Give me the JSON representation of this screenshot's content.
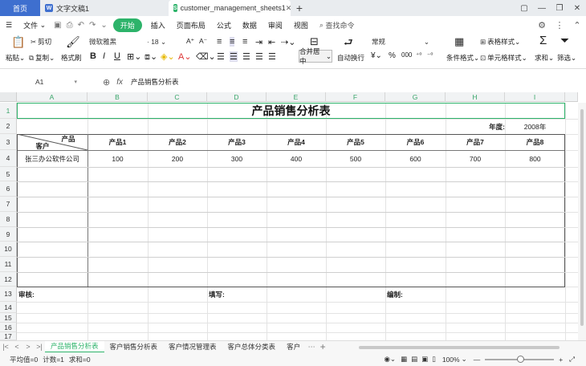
{
  "tabs": [
    {
      "label": "首页"
    },
    {
      "label": "文字文稿1"
    },
    {
      "label": "customer_management_sheets1"
    }
  ],
  "menu": {
    "file": "文件",
    "start": "开始",
    "items": [
      "插入",
      "页面布局",
      "公式",
      "数据",
      "审阅",
      "视图"
    ],
    "search": "查找命令"
  },
  "ribbon": {
    "cut": "剪切",
    "paste": "粘贴",
    "copy": "复制",
    "format_painter": "格式刷",
    "font_name": "微软雅黑",
    "font_size": "18",
    "merge_center": "合并居中",
    "wrap": "自动换行",
    "number_format": "常规",
    "conditional": "条件格式",
    "table_style": "表格样式",
    "cell_style": "单元格样式",
    "sum": "求和",
    "filter": "筛选"
  },
  "formula_bar": {
    "cell_ref": "A1",
    "fx": "fx",
    "content": "产品销售分析表"
  },
  "columns": [
    "A",
    "B",
    "C",
    "D",
    "E",
    "F",
    "G",
    "H",
    "I"
  ],
  "rows": [
    "1",
    "2",
    "3",
    "4",
    "5",
    "6",
    "7",
    "8",
    "9",
    "10",
    "11",
    "12",
    "13",
    "14",
    "15",
    "16",
    "17"
  ],
  "sheet": {
    "title": "产品销售分析表",
    "year_label": "年度:",
    "year_value": "2008年",
    "header_top": "产品",
    "header_bottom": "客户",
    "products": [
      "产品1",
      "产品2",
      "产品3",
      "产品4",
      "产品5",
      "产品6",
      "产品7",
      "产品8"
    ],
    "customer": "张三办公软件公司",
    "values": [
      "100",
      "200",
      "300",
      "400",
      "500",
      "600",
      "700",
      "800"
    ],
    "review": "审核:",
    "fill": "填写:",
    "compile": "编制:"
  },
  "sheet_tabs": [
    "产品销售分析表",
    "客户销售分析表",
    "客户情况管理表",
    "客户总体分类表",
    "客户"
  ],
  "status": {
    "average": "平均值=0",
    "count": "计数=1",
    "sum": "求和=0",
    "zoom": "100%"
  },
  "colors": {
    "accent": "#2db36a",
    "home_tab": "#3e6fcf"
  }
}
